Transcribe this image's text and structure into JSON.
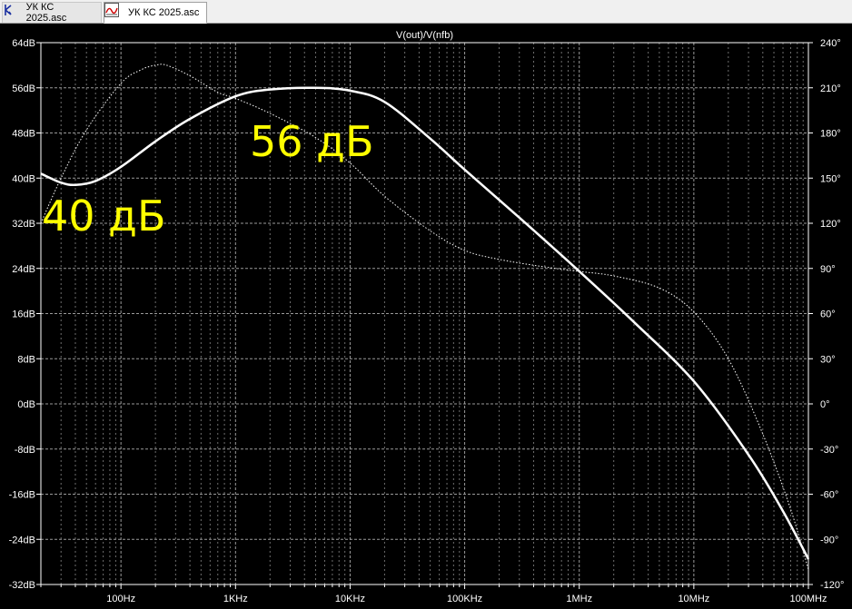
{
  "tabs": [
    {
      "label": "УК КС 2025.asc",
      "icon": "schematic-icon"
    },
    {
      "label": "УК КС 2025.asc",
      "icon": "waveform-icon"
    }
  ],
  "chart_data": {
    "type": "line",
    "title": "V(out)/V(nfb)",
    "x_scale": "log",
    "xlim": [
      20,
      100000000
    ],
    "x_ticks": [
      {
        "value": 100,
        "label": "100Hz"
      },
      {
        "value": 1000,
        "label": "1KHz"
      },
      {
        "value": 10000,
        "label": "10KHz"
      },
      {
        "value": 100000,
        "label": "100KHz"
      },
      {
        "value": 1000000,
        "label": "1MHz"
      },
      {
        "value": 10000000,
        "label": "10MHz"
      },
      {
        "value": 100000000,
        "label": "100MHz"
      }
    ],
    "y_left": {
      "ylim": [
        -32,
        64
      ],
      "ticks": [
        "64dB",
        "56dB",
        "48dB",
        "40dB",
        "32dB",
        "24dB",
        "16dB",
        "8dB",
        "0dB",
        "-8dB",
        "-16dB",
        "-24dB",
        "-32dB"
      ]
    },
    "y_right": {
      "ylim": [
        -120,
        240
      ],
      "ticks": [
        "240°",
        "210°",
        "180°",
        "150°",
        "120°",
        "90°",
        "60°",
        "30°",
        "0°",
        "-30°",
        "-60°",
        "-90°",
        "-120°"
      ]
    },
    "grid": true,
    "series": [
      {
        "axis": "left",
        "style": "solid",
        "color": "#ffffff",
        "x": [
          20,
          30,
          40,
          60,
          100,
          200,
          400,
          1000,
          2000,
          5000,
          10000,
          20000,
          50000,
          100000,
          300000,
          1000000,
          3000000,
          10000000,
          30000000,
          60000000,
          100000000
        ],
        "values": [
          40.8,
          39.2,
          38.8,
          39.5,
          42,
          46.5,
          50.5,
          54.5,
          55.7,
          56,
          55.5,
          53.5,
          47,
          41.5,
          33,
          23.5,
          14.5,
          4,
          -9,
          -19,
          -27.5
        ]
      },
      {
        "axis": "right",
        "style": "dotted",
        "color": "#ffffff",
        "x": [
          20,
          30,
          50,
          100,
          150,
          200,
          250,
          400,
          700,
          1000,
          2000,
          5000,
          10000,
          20000,
          50000,
          100000,
          200000,
          500000,
          1000000,
          2000000,
          5000000,
          10000000,
          20000000,
          40000000,
          70000000,
          100000000
        ],
        "values": [
          120,
          150,
          182,
          213,
          222,
          225,
          225,
          218,
          207,
          203,
          193,
          177,
          160,
          138,
          115,
          102,
          96,
          91,
          88,
          85,
          77,
          61,
          30,
          -20,
          -70,
          -110
        ]
      }
    ]
  },
  "annotations": [
    {
      "text": "56 дБ",
      "color": "#ffff00"
    },
    {
      "text": "40 дБ",
      "color": "#ffff00"
    }
  ]
}
